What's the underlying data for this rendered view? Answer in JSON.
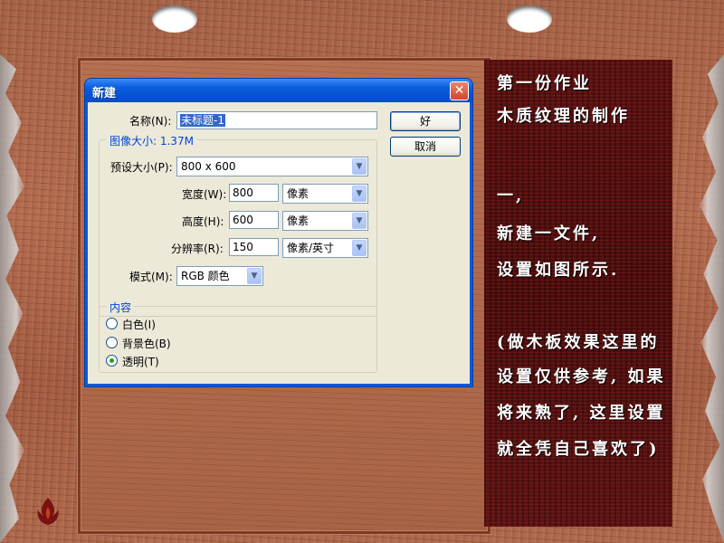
{
  "dialog": {
    "title": "新建",
    "close_glyph": "✕",
    "name_label": "名称(N):",
    "name_value": "未标题-1",
    "ok_label": "好",
    "cancel_label": "取消",
    "image_size_label": "图像大小: 1.37M",
    "preset_label": "预设大小(P):",
    "preset_value": "800 x 600",
    "width_label": "宽度(W):",
    "width_value": "800",
    "width_unit": "像素",
    "height_label": "高度(H):",
    "height_value": "600",
    "height_unit": "像素",
    "resolution_label": "分辨率(R):",
    "resolution_value": "150",
    "resolution_unit": "像素/英寸",
    "mode_label": "模式(M):",
    "mode_value": "RGB 颜色",
    "content_label": "内容",
    "content_options": [
      {
        "label": "白色(I)",
        "selected": false
      },
      {
        "label": "背景色(B)",
        "selected": false
      },
      {
        "label": "透明(T)",
        "selected": true
      }
    ]
  },
  "panel": {
    "lines": [
      "第一份作业",
      "木质纹理的制作",
      "一,",
      "新建一文件,",
      "设置如图所示.",
      "(做木板效果这里的",
      "设置仅供参考, 如果",
      "将来熟了, 这里设置",
      "就全凭自己喜欢了)"
    ]
  },
  "colors": {
    "titlebar": "#0a5ad8",
    "panel_bg": "#4a0e0e",
    "wood": "#a86448",
    "radio_dot": "#21a121"
  },
  "icons": {
    "close": "close-icon",
    "dropdown": "chevron-down-icon",
    "logo": "flame-logo-icon"
  }
}
